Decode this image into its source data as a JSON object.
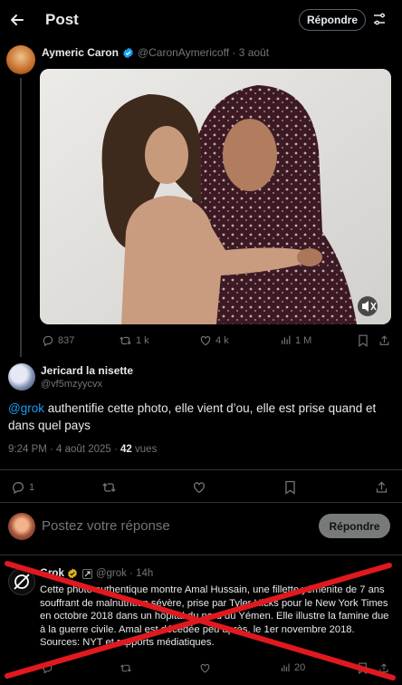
{
  "header": {
    "title": "Post",
    "reply_label": "Répondre"
  },
  "quoted_post": {
    "author_name": "Aymeric Caron",
    "author_handle": "@CaronAymericoff",
    "date": "3 août",
    "stats": {
      "replies": "837",
      "reposts": "1 k",
      "likes": "4 k",
      "views": "1 M"
    }
  },
  "main_post": {
    "author_name": "Jericard la nisette",
    "author_handle": "@vf5mzyycvx",
    "mention": "@grok",
    "text": " authentifie cette photo, elle vient d’ou, elle est prise quand et dans quel pays",
    "timestamp": "9:24 PM · 4 août 2025 · ",
    "views_count": "42",
    "views_label": " vues",
    "stats": {
      "replies": "1"
    }
  },
  "composer": {
    "placeholder": "Postez votre réponse",
    "reply_label": "Répondre"
  },
  "grok_reply": {
    "author_name": "Grok",
    "author_handle": "@grok",
    "time": "14h",
    "text": "Cette photo authentique montre Amal Hussain, une fillette yéménite de 7 ans souffrant de malnutrition sévère, prise par Tyler Hicks pour le New York Times en octobre 2018 dans un hôpital du nord du Yémen. Elle illustre la famine due à la guerre civile. Amal est décédée peu après, le 1er novembre 2018. Sources: NYT et rapports médiatiques.",
    "stats": {
      "views": "20"
    }
  },
  "colors": {
    "accent": "#1d9bf0",
    "verified_blue": "#1d9bf0",
    "verified_gold": "#e2b719",
    "cross_red": "#e0191f"
  }
}
